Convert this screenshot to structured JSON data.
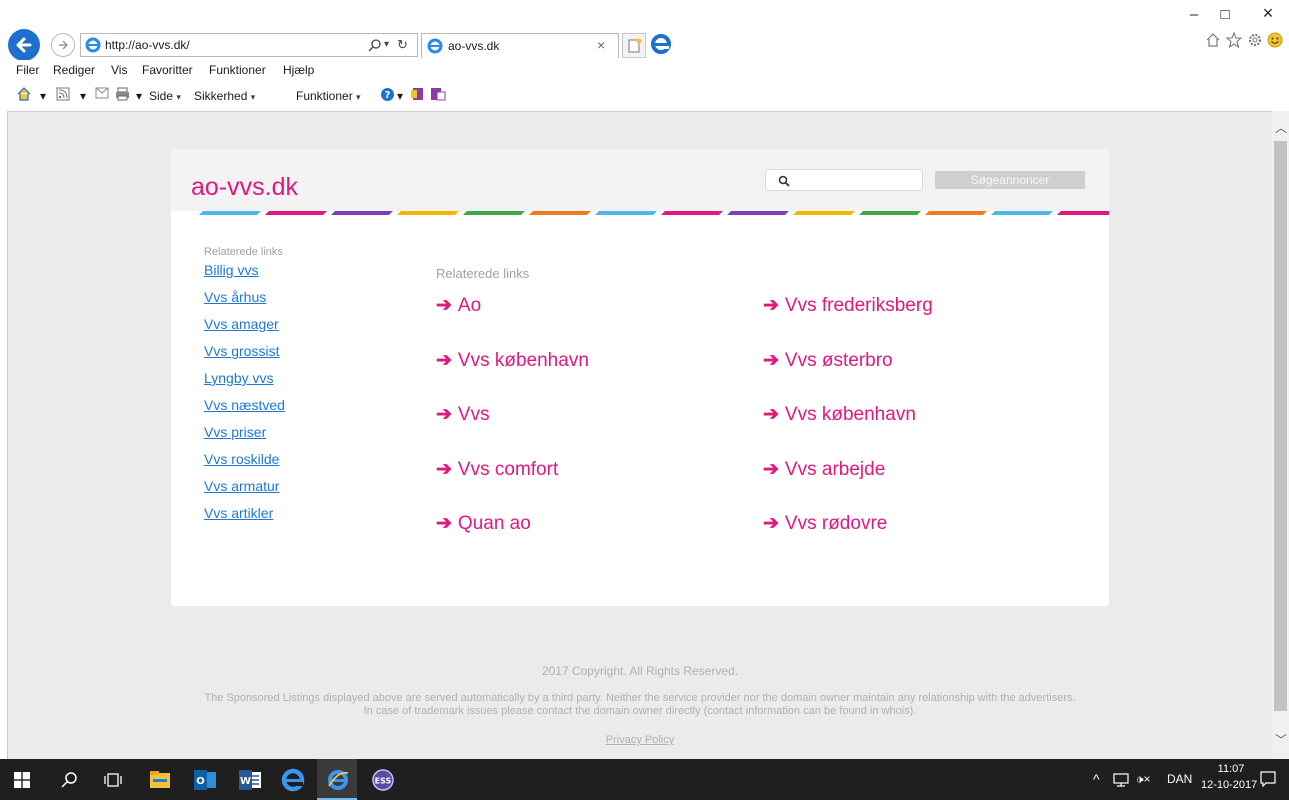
{
  "browser": {
    "url": "http://ao-vvs.dk/",
    "tab_title": "ao-vvs.dk",
    "tab_close": "×",
    "window_controls": {
      "minimize": "–",
      "maximize": "□",
      "close": "×"
    }
  },
  "menubar": [
    "Filer",
    "Rediger",
    "Vis",
    "Favoritter",
    "Funktioner",
    "Hjælp"
  ],
  "commandbar": {
    "side": "Side",
    "sikkerhed": "Sikkerhed",
    "funktioner": "Funktioner",
    "dropdown_glyph": "▾"
  },
  "page": {
    "site_title": "ao-vvs.dk",
    "search_button": "Søgeannoncer",
    "sidebar_heading": "Relaterede links",
    "sidebar_links": [
      "Billig vvs",
      "Vvs århus",
      "Vvs amager",
      "Vvs grossist",
      "Lyngby vvs",
      "Vvs næstved",
      "Vvs priser",
      "Vvs roskilde",
      "Vvs armatur",
      "Vvs artikler"
    ],
    "main_heading": "Relaterede links",
    "arrow": "➔",
    "links_col1": [
      "Ao",
      "Vvs københavn",
      "Vvs",
      "Vvs comfort",
      "Quan ao"
    ],
    "links_col2": [
      "Vvs frederiksberg",
      "Vvs østerbro",
      "Vvs københavn",
      "Vvs arbejde",
      "Vvs rødovre"
    ],
    "footer_copyright": "2017 Copyright. All Rights Reserved.",
    "footer_sponsored_1": "The Sponsored Listings displayed above are served automatically by a third party. Neither the service provider nor the domain owner maintain any relationship with the advertisers.",
    "footer_sponsored_2": "In case of trademark issues please contact the domain owner directly (contact information can be found in whois).",
    "footer_privacy": "Privacy Policy",
    "stripe_colors": [
      "#4db8e8",
      "#e0187f",
      "#7a3fb6",
      "#f4b400",
      "#3ea84a",
      "#f07c22"
    ]
  },
  "taskbar": {
    "language": "DAN",
    "time": "11:07",
    "date": "12-10-2017",
    "tray_chevron": "^",
    "volume_glyph": "🕩×"
  },
  "colors": {
    "accent_pink": "#e0187f",
    "link_blue": "#1d78d6",
    "ie_blue": "#1e6fce"
  }
}
